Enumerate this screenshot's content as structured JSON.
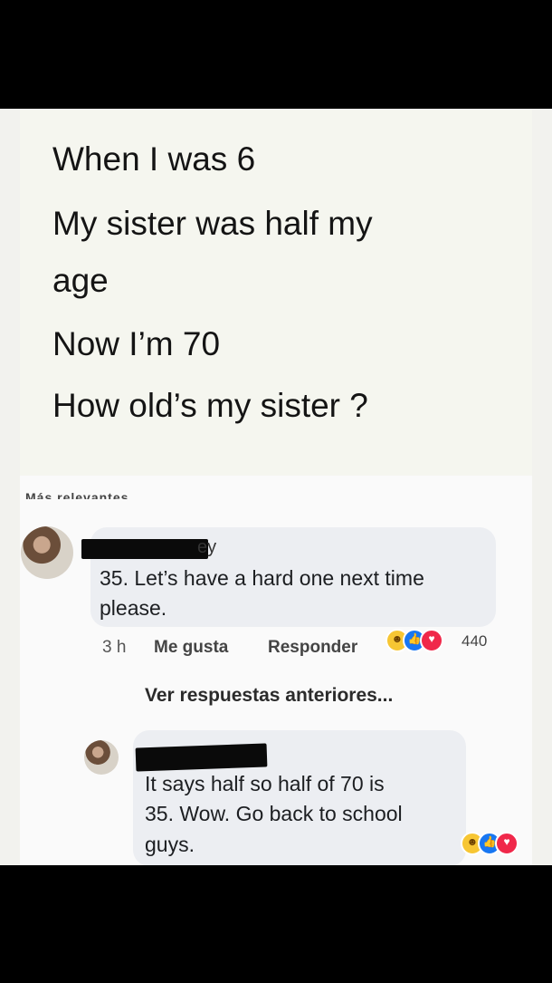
{
  "post": {
    "lines": [
      "When I was 6",
      "My sister was half my",
      "age",
      "Now I’m 70",
      "How old’s my sister ?"
    ]
  },
  "relevance_label": "Más relevantes",
  "comment1": {
    "name_fragment": "ey",
    "text_lines": [
      "35. Let’s have a hard one next time",
      "please."
    ],
    "time": "3 h",
    "like_label": "Me gusta",
    "reply_label": "Responder",
    "reaction_count": "440",
    "reactions": [
      "haha-icon",
      "like-icon",
      "love-icon"
    ]
  },
  "more_replies": "Ver respuestas anteriores...",
  "comment2": {
    "text_lines": [
      "It says half so half of 70 is",
      "35. Wow. Go back to school",
      "guys."
    ],
    "reactions": [
      "haha-icon",
      "like-icon",
      "love-icon"
    ]
  },
  "colors": {
    "like": "#1877f2",
    "love": "#f0284a",
    "haha": "#f7c633",
    "bubble": "#eceef2"
  }
}
